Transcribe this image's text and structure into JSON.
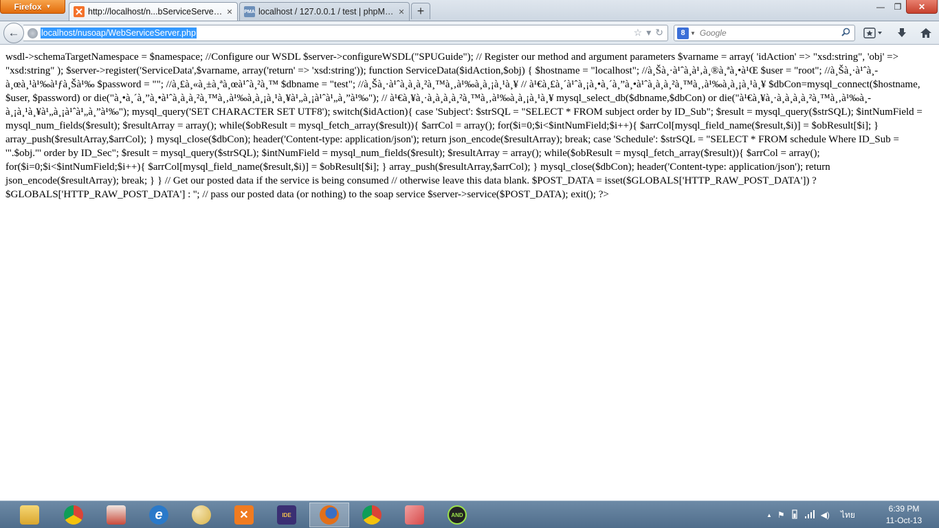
{
  "browser": {
    "menu_label": "Firefox",
    "tabs": [
      {
        "label": "http://localhost/n...bServiceServer.php",
        "active": true
      },
      {
        "label": "localhost / 127.0.0.1 / test | phpMyAd...",
        "active": false,
        "favicon_text": "PMA"
      }
    ],
    "new_tab_label": "+",
    "window": {
      "minimize": "—",
      "maximize": "❐",
      "close": "✕"
    }
  },
  "navbar": {
    "back_glyph": "←",
    "url": "localhost/nusoap/WebServiceServer.php",
    "search_placeholder": "Google",
    "search_engine_glyph": "8",
    "bookmark_star": "☆",
    "dropdown": "▾",
    "reload": "↻"
  },
  "page": {
    "text": "wsdl->schemaTargetNamespace = $namespace; //Configure our WSDL $server->configureWSDL(\"SPUGuide\"); // Register our method and argument parameters $varname = array( 'idAction' => \"xsd:string\", 'obj' => \"xsd:string\" ); $server->register('ServiceData',$varname, array('return' => 'xsd:string')); function ServiceData($idAction,$obj) { $hostname = \"localhost\"; //à¸Šà¸·à¹ˆà¸­à¹‚à¸®à¸ªà¸•à¹Œ $user = \"root\"; //à¸Šà¸·à¹ˆà¸­à¸œà¸¹à¹‰à¹ƒà¸Šà¹‰ $password = \"\"; //à¸£à¸«à¸±à¸ªà¸œà¹ˆà¸²à¸™ $dbname = \"test\"; //à¸Šà¸·à¹ˆà¸­à¸à¸²à¸™à¸‚à¹‰à¸­à¸¡à¸¹à¸¥ // à¹€à¸£à¸´à¹ˆà¸¡à¸•à¸´à¸”à¸•à¹ˆà¸­à¸à¸²à¸™à¸‚à¹‰à¸­à¸¡à¸¹à¸¥ $dbCon=mysql_connect($hostname, $user, $password) or die(\"à¸•à¸´à¸”à¸•à¹ˆà¸­à¸à¸²à¸™à¸‚à¹‰à¸­à¸¡à¸¹à¸¥à¹„à¸¡à¹ˆà¹„à¸”à¹‰\"); // à¹€à¸¥à¸·à¸­à¸à¸à¸²à¸™à¸‚à¹‰à¸­à¸¡à¸¹à¸¥ mysql_select_db($dbname,$dbCon) or die(\"à¹€à¸¥à¸·à¸­à¸à¸à¸²à¸™à¸‚à¹‰à¸­à¸¡à¸¹à¸¥à¹„à¸¡à¹ˆà¹„à¸”à¹‰\"); mysql_query('SET CHARACTER SET UTF8'); switch($idAction){ case 'Subject': $strSQL = \"SELECT * FROM subject order by ID_Sub\"; $result = mysql_query($strSQL); $intNumField = mysql_num_fields($result); $resultArray = array(); while($obResult = mysql_fetch_array($result)){ $arrCol = array(); for($i=0;$i<$intNumField;$i++){ $arrCol[mysql_field_name($result,$i)] = $obResult[$i]; } array_push($resultArray,$arrCol); } mysql_close($dbCon); header('Content-type: application/json'); return json_encode($resultArray); break; case 'Schedule': $strSQL = \"SELECT * FROM schedule Where ID_Sub = '\".$obj.\"' order by ID_Sec\"; $result = mysql_query($strSQL); $intNumField = mysql_num_fields($result); $resultArray = array(); while($obResult = mysql_fetch_array($result)){ $arrCol = array(); for($i=0;$i<$intNumField;$i++){ $arrCol[mysql_field_name($result,$i)] = $obResult[$i]; } array_push($resultArray,$arrCol); } mysql_close($dbCon); header('Content-type: application/json'); return json_encode($resultArray); break; } } // Get our posted data if the service is being consumed // otherwise leave this data blank. $POST_DATA = isset($GLOBALS['HTTP_RAW_POST_DATA']) ? $GLOBALS['HTTP_RAW_POST_DATA'] : ''; // pass our posted data (or nothing) to the soap service $server->service($POST_DATA); exit(); ?>"
  },
  "taskbar": {
    "apps": [
      {
        "name": "file-explorer-icon",
        "color": "#e8b84a",
        "label": ""
      },
      {
        "name": "chrome-icon",
        "color": "#e0463a",
        "label": ""
      },
      {
        "name": "editor-icon",
        "color": "#c94b3b",
        "label": ""
      },
      {
        "name": "internet-explorer-icon",
        "color": "#2a79c9",
        "label": "e"
      },
      {
        "name": "paint-icon",
        "color": "#d9b44a",
        "label": ""
      },
      {
        "name": "xampp-icon",
        "color": "#f07b20",
        "label": "✕"
      },
      {
        "name": "java-ee-ide-icon",
        "color": "#3a2f73",
        "label": "IDE"
      },
      {
        "name": "firefox-icon",
        "color": "#e2701a",
        "label": ""
      },
      {
        "name": "chrome-icon",
        "color": "#e0463a",
        "label": ""
      },
      {
        "name": "notes-icon",
        "color": "#d64a4a",
        "label": ""
      },
      {
        "name": "android-emulator-icon",
        "color": "#222222",
        "label": "AND"
      }
    ],
    "tray": {
      "show_hidden": "▲",
      "flag": "⚑",
      "network": "▮",
      "volume": "◀)",
      "language": "ไทย"
    },
    "clock": {
      "time": "6:39 PM",
      "date": "11-Oct-13"
    }
  }
}
